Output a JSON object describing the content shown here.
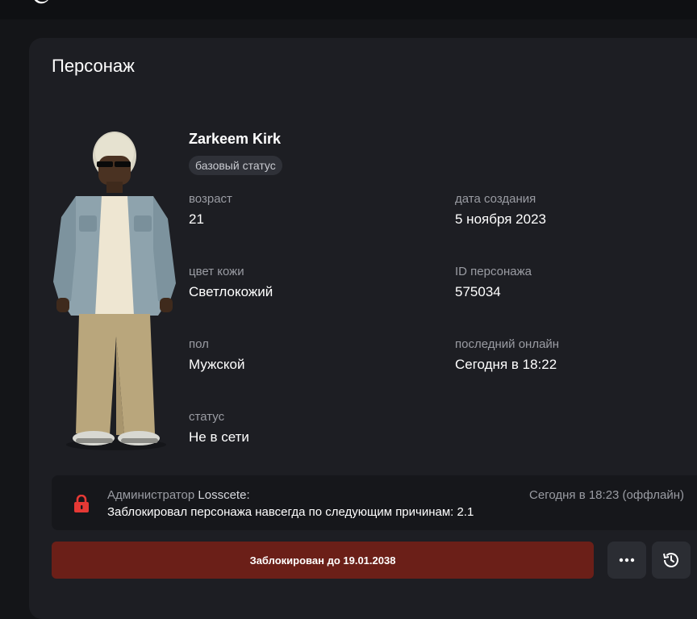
{
  "header": {
    "logo_icon": "moon-logo-icon"
  },
  "card": {
    "title": "Персонаж"
  },
  "character": {
    "name": "Zarkeem Kirk",
    "status_badge": "базовый статус",
    "avatar_icon": "character-avatar-image",
    "fields": {
      "age": {
        "label": "возраст",
        "value": "21"
      },
      "created": {
        "label": "дата создания",
        "value": "5 ноября 2023"
      },
      "skin": {
        "label": "цвет кожи",
        "value": "Светлокожий"
      },
      "id": {
        "label": "ID персонажа",
        "value": "575034"
      },
      "gender": {
        "label": "пол",
        "value": "Мужской"
      },
      "last_online": {
        "label": "последний онлайн",
        "value": "Сегодня в 18:22"
      },
      "status": {
        "label": "статус",
        "value": "Не в сети"
      }
    }
  },
  "ban_log": {
    "icon": "lock-icon",
    "icon_color": "#e53935",
    "admin_role": "Администратор",
    "admin_name": "Losscete:",
    "time": "Сегодня в 18:23 (оффлайн)",
    "message": "Заблокировал персонажа навсегда по следующим причинам: 2.1"
  },
  "actions": {
    "ban_label": "Заблокирован до 19.01.2038",
    "ban_color": "#6b1f18",
    "more_icon": "more-dots-icon",
    "history_icon": "history-icon"
  }
}
